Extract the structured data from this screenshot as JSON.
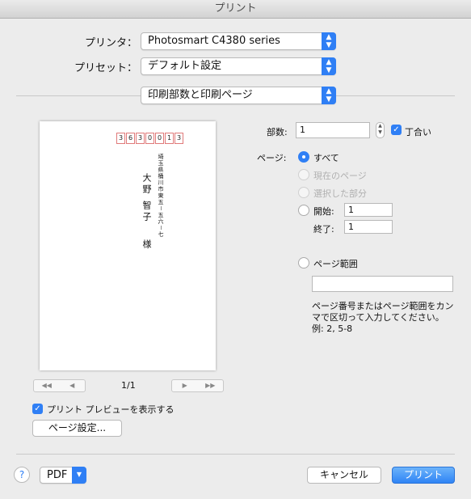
{
  "window": {
    "title": "プリント"
  },
  "printer": {
    "label": "プリンタ：",
    "value": "Photosmart C4380 series"
  },
  "preset": {
    "label": "プリセット：",
    "value": "デフォルト設定"
  },
  "section": {
    "value": "印刷部数と印刷ページ"
  },
  "preview": {
    "zip": [
      "3",
      "6",
      "3",
      "0",
      "0",
      "1",
      "3"
    ],
    "address": "埼玉県桶川市東五－五六－七",
    "name": [
      "大野",
      "智子",
      "様"
    ],
    "page_counter": "1/1"
  },
  "show_preview": {
    "label": "プリント プレビューを表示する",
    "checked": true
  },
  "page_setup_button": "ページ設定...",
  "copies": {
    "label": "部数:",
    "value": "1",
    "collate_label": "丁合い",
    "collate_checked": true
  },
  "pages": {
    "label": "ページ:",
    "options": {
      "all": "すべて",
      "current": "現在のページ",
      "selection": "選択した部分",
      "from": "開始:",
      "to": "終了:",
      "range": "ページ範囲"
    },
    "from_value": "1",
    "to_value": "1",
    "range_value": "",
    "help_text": [
      "ページ番号またはページ範囲をカン",
      "マで区切って入力してください。",
      "例: 2, 5-8"
    ]
  },
  "footer": {
    "help": "?",
    "pdf": "PDF",
    "cancel": "キャンセル",
    "print": "プリント"
  },
  "colors": {
    "accent": "#2f7ff5",
    "zip_box": "#e07a7a"
  }
}
